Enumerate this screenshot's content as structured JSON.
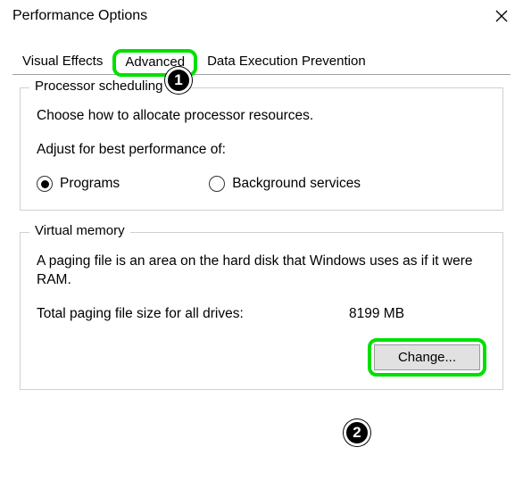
{
  "window": {
    "title": "Performance Options"
  },
  "tabs": {
    "visual_effects": "Visual Effects",
    "advanced": "Advanced",
    "dep": "Data Execution Prevention"
  },
  "annotations": {
    "badge1": "1",
    "badge2": "2"
  },
  "processor": {
    "group_title": "Processor scheduling",
    "desc": "Choose how to allocate processor resources.",
    "adjust_label": "Adjust for best performance of:",
    "programs": "Programs",
    "background": "Background services",
    "selected": "programs"
  },
  "vm": {
    "group_title": "Virtual memory",
    "desc": "A paging file is an area on the hard disk that Windows uses as if it were RAM.",
    "total_label": "Total paging file size for all drives:",
    "total_value": "8199 MB",
    "change_btn": "Change..."
  }
}
